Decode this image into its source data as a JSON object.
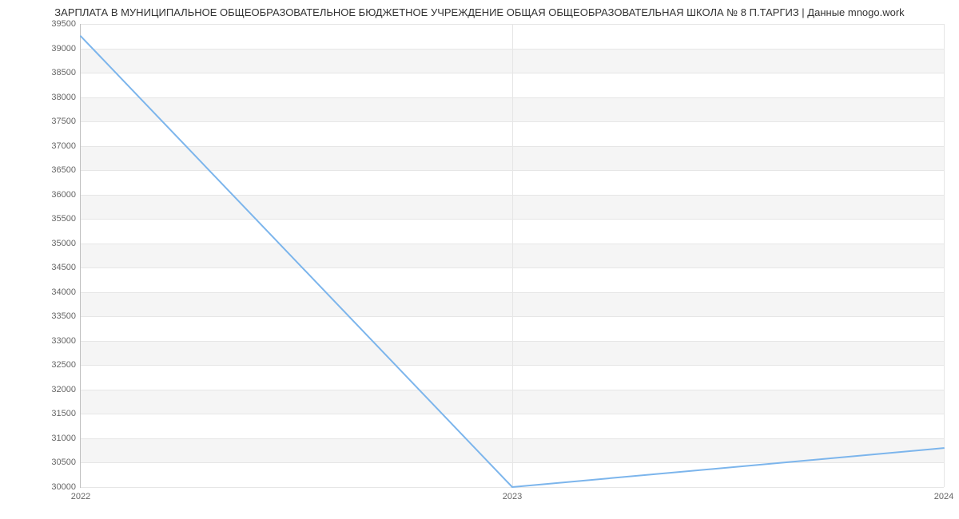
{
  "chart_data": {
    "type": "line",
    "title": "ЗАРПЛАТА В МУНИЦИПАЛЬНОЕ ОБЩЕОБРАЗОВАТЕЛЬНОЕ БЮДЖЕТНОЕ УЧРЕЖДЕНИЕ ОБЩАЯ ОБЩЕОБРАЗОВАТЕЛЬНАЯ ШКОЛА № 8 П.ТАРГИЗ | Данные mnogo.work",
    "xlabel": "",
    "ylabel": "",
    "categories": [
      "2022",
      "2023",
      "2024"
    ],
    "x": [
      2022,
      2023,
      2024
    ],
    "values": [
      39250,
      30000,
      30800
    ],
    "ylim": [
      30000,
      39500
    ],
    "yticks": [
      30000,
      30500,
      31000,
      31500,
      32000,
      32500,
      33000,
      33500,
      34000,
      34500,
      35000,
      35500,
      36000,
      36500,
      37000,
      37500,
      38000,
      38500,
      39000,
      39500
    ],
    "line_color": "#7cb5ec"
  }
}
